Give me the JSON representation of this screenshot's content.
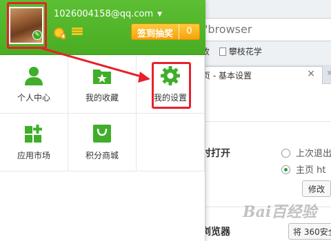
{
  "browser": {
    "address_text": "'browser",
    "bookmarks": [
      "收",
      "攀枝花学"
    ],
    "active_tab_title": "页 - 基本设置",
    "tab_close": "×",
    "new_tab": "»",
    "settings": {
      "section_startup": "时打开",
      "option_last": "上次退出",
      "option_home": "主页   ht",
      "modify_button": "修改",
      "section_default": "浏览器",
      "default_button": "将 360安全"
    },
    "watermark": "Bai百经验"
  },
  "panel": {
    "email": "1026004158@qq.com",
    "checkin_label": "签到抽奖",
    "checkin_count": "0",
    "level_badge": "4",
    "grid": [
      {
        "label": "个人中心",
        "icon": "person-icon"
      },
      {
        "label": "我的收藏",
        "icon": "folder-star-icon"
      },
      {
        "label": "我的设置",
        "icon": "gear-icon"
      },
      {
        "label": "应用市场",
        "icon": "apps-grid-icon"
      },
      {
        "label": "积分商城",
        "icon": "shopping-bag-icon"
      }
    ]
  },
  "colors": {
    "brand_green": "#4caf24",
    "highlight_red": "#e8202a",
    "checkin_orange": "#f5a20c"
  }
}
